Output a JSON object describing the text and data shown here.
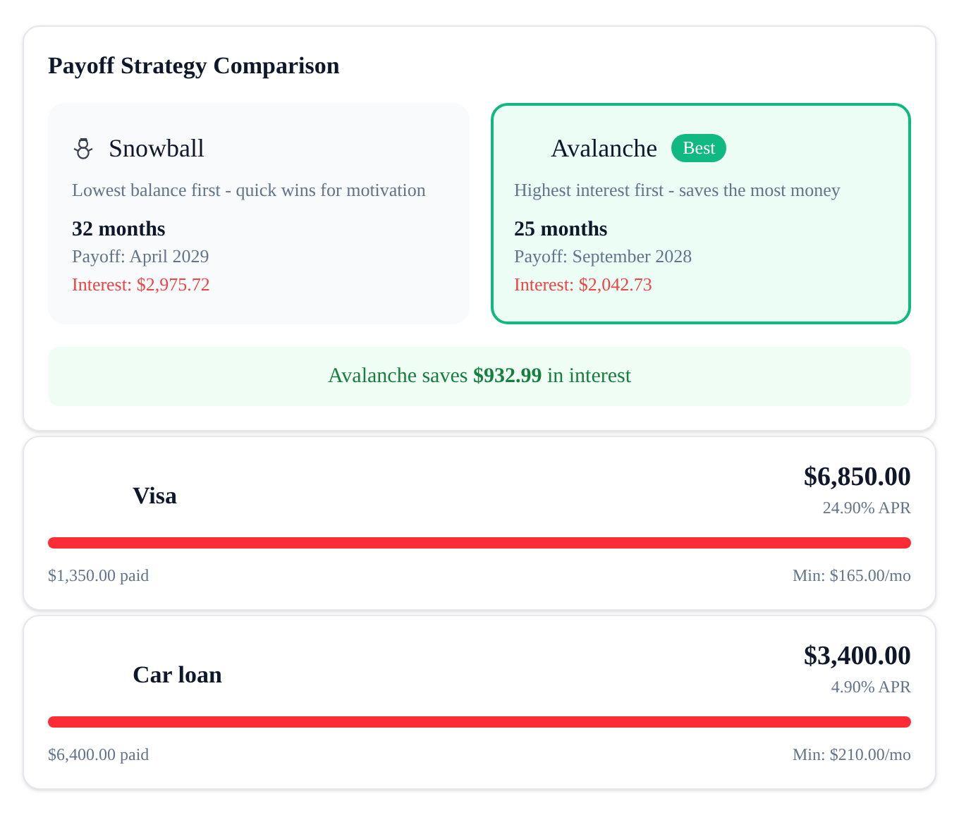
{
  "comparison": {
    "title": "Payoff Strategy Comparison",
    "strategies": [
      {
        "kind": "snowball",
        "name": "Snowball",
        "selected": false,
        "description": "Lowest balance first - quick wins for motivation",
        "months": "32 months",
        "payoff": "Payoff: April 2029",
        "interest": "Interest: $2,975.72"
      },
      {
        "kind": "avalanche",
        "name": "Avalanche",
        "badge": "Best",
        "selected": true,
        "description": "Highest interest first - saves the most money",
        "months": "25 months",
        "payoff": "Payoff: September 2028",
        "interest": "Interest: $2,042.73"
      }
    ],
    "savings": "Avalanche saves **$932.99** in interest"
  },
  "debts": [
    {
      "name": "Visa",
      "balance": "$6,850.00",
      "apr": "24.90% APR",
      "level": 1,
      "paid": "$1,350.00 paid",
      "minimum": "Min: $165.00/mo"
    },
    {
      "name": "Car loan",
      "balance": "$3,400.00",
      "apr": "4.90% APR",
      "level": 1,
      "paid": "$6,400.00 paid",
      "minimum": "Min: $210.00/mo"
    }
  ]
}
